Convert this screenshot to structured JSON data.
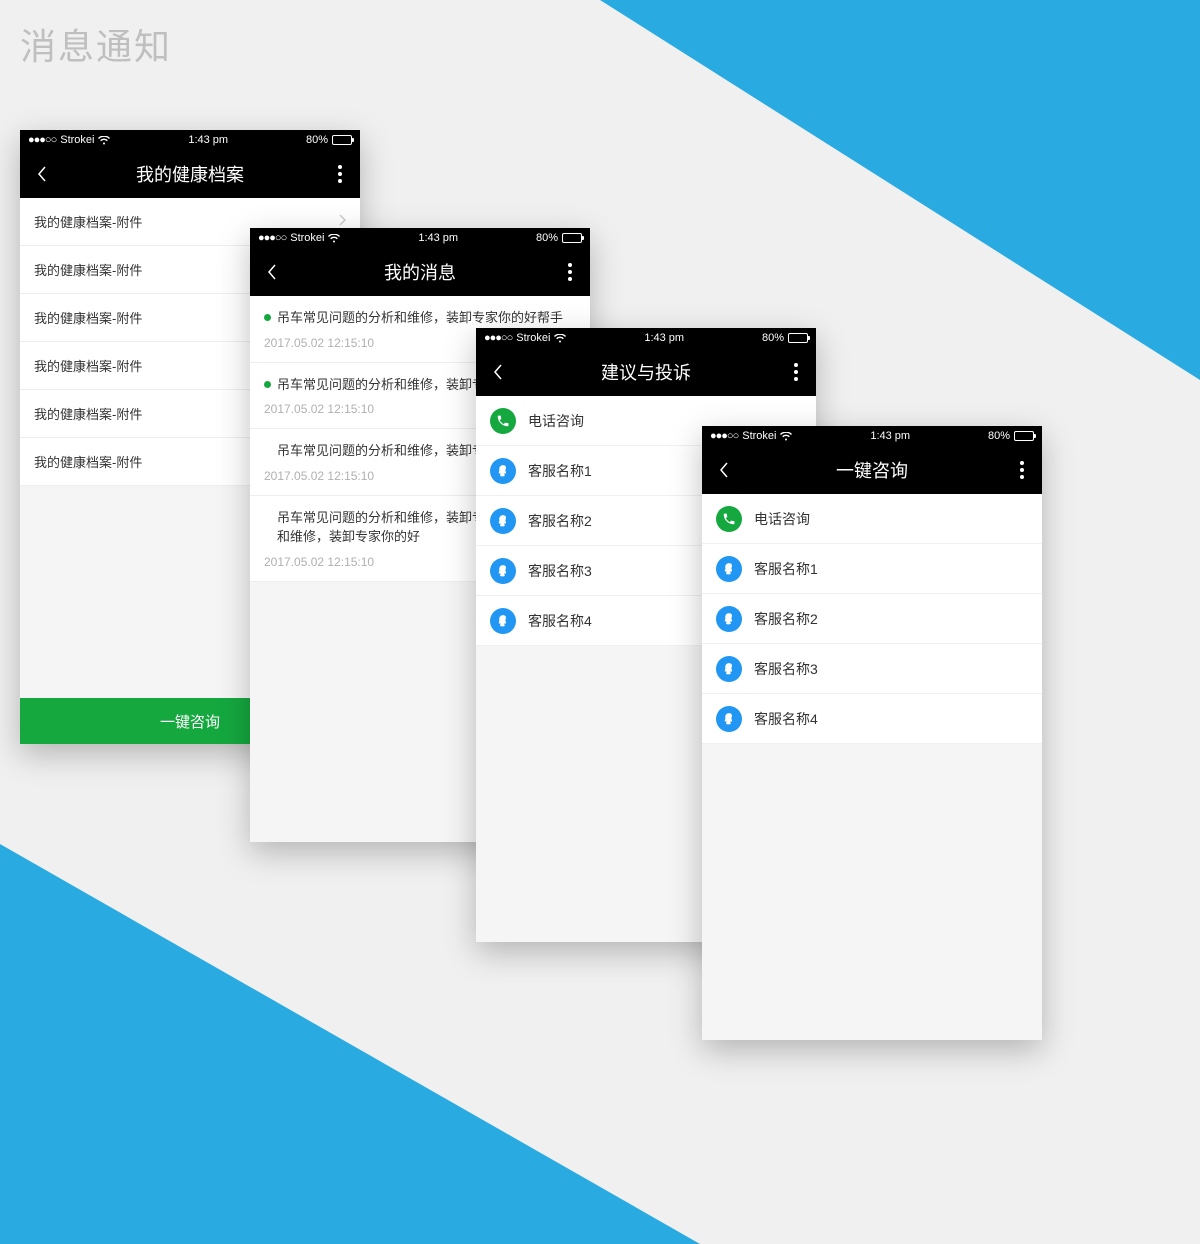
{
  "page_title": "消息通知",
  "status": {
    "carrier": "Strokei",
    "time": "1:43 pm",
    "battery_pct": "80%"
  },
  "phone1": {
    "nav_title": "我的健康档案",
    "rows": [
      {
        "label": "我的健康档案-附件",
        "chevron": true
      },
      {
        "label": "我的健康档案-附件"
      },
      {
        "label": "我的健康档案-附件"
      },
      {
        "label": "我的健康档案-附件"
      },
      {
        "label": "我的健康档案-附件"
      },
      {
        "label": "我的健康档案-附件"
      }
    ],
    "footer_btn": "一键咨询"
  },
  "phone2": {
    "nav_title": "我的消息",
    "messages": [
      {
        "unread": true,
        "title": "吊车常见问题的分析和维修，装卸专家你的好帮手",
        "time": "2017.05.02 12:15:10"
      },
      {
        "unread": true,
        "title": "吊车常见问题的分析和维修，装卸专",
        "time": "2017.05.02 12:15:10"
      },
      {
        "unread": false,
        "title": "吊车常见问题的分析和维修，装卸专家",
        "time": "2017.05.02 12:15:10"
      },
      {
        "unread": false,
        "title": "吊车常见问题的分析和维修，装卸专家见问题的分析和维修，装卸专家你的好",
        "time": "2017.05.02 12:15:10"
      }
    ]
  },
  "phone3": {
    "nav_title": "建议与投诉",
    "contacts": [
      {
        "type": "phone",
        "label": "电话咨询"
      },
      {
        "type": "qq",
        "label": "客服名称1"
      },
      {
        "type": "qq",
        "label": "客服名称2"
      },
      {
        "type": "qq",
        "label": "客服名称3"
      },
      {
        "type": "qq",
        "label": "客服名称4"
      }
    ]
  },
  "phone4": {
    "nav_title": "一键咨询",
    "contacts": [
      {
        "type": "phone",
        "label": "电话咨询"
      },
      {
        "type": "qq",
        "label": "客服名称1"
      },
      {
        "type": "qq",
        "label": "客服名称2"
      },
      {
        "type": "qq",
        "label": "客服名称3"
      },
      {
        "type": "qq",
        "label": "客服名称4"
      }
    ]
  }
}
